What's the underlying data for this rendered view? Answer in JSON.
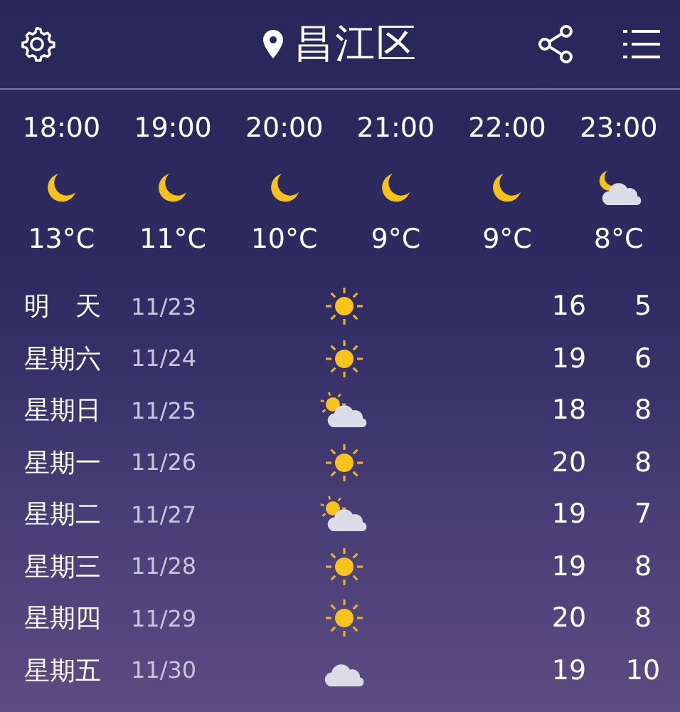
{
  "header": {
    "location": "昌江区"
  },
  "hourly": [
    {
      "time": "18:00",
      "kind": "moon",
      "temp": "13°C"
    },
    {
      "time": "19:00",
      "kind": "moon",
      "temp": "11°C"
    },
    {
      "time": "20:00",
      "kind": "moon",
      "temp": "10°C"
    },
    {
      "time": "21:00",
      "kind": "moon",
      "temp": "9°C"
    },
    {
      "time": "22:00",
      "kind": "moon",
      "temp": "9°C"
    },
    {
      "time": "23:00",
      "kind": "cloudmoon",
      "temp": "8°C"
    }
  ],
  "daily": [
    {
      "day": "明　天",
      "date": "11/23",
      "kind": "sun",
      "high": "16",
      "low": "5"
    },
    {
      "day": "星期六",
      "date": "11/24",
      "kind": "sun",
      "high": "19",
      "low": "6"
    },
    {
      "day": "星期日",
      "date": "11/25",
      "kind": "partly",
      "high": "18",
      "low": "8"
    },
    {
      "day": "星期一",
      "date": "11/26",
      "kind": "sun",
      "high": "20",
      "low": "8"
    },
    {
      "day": "星期二",
      "date": "11/27",
      "kind": "partly",
      "high": "19",
      "low": "7"
    },
    {
      "day": "星期三",
      "date": "11/28",
      "kind": "sun",
      "high": "19",
      "low": "8"
    },
    {
      "day": "星期四",
      "date": "11/29",
      "kind": "sun",
      "high": "20",
      "low": "8"
    },
    {
      "day": "星期五",
      "date": "11/30",
      "kind": "cloud",
      "high": "19",
      "low": "10"
    }
  ]
}
